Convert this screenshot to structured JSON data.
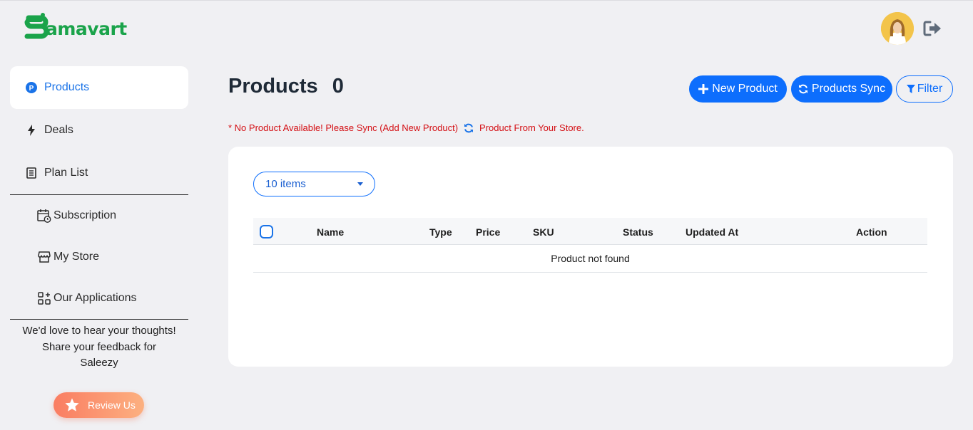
{
  "brand": {
    "name": "amavart",
    "color": "#1aa34a"
  },
  "header": {
    "avatar_icon": "user-avatar",
    "logout_icon": "sign-out-icon"
  },
  "sidebar": {
    "items": [
      {
        "label": "Products",
        "icon": "product-p-icon",
        "active": true
      },
      {
        "label": "Deals",
        "icon": "bolt-icon",
        "active": false
      },
      {
        "label": "Plan List",
        "icon": "list-icon",
        "active": false
      }
    ],
    "sub_items": [
      {
        "label": "Subscription",
        "icon": "calendar-clock-icon"
      },
      {
        "label": "My Store",
        "icon": "store-icon"
      },
      {
        "label": "Our Applications",
        "icon": "apps-icon"
      }
    ],
    "feedback": {
      "line1": "We'd love to hear your thoughts!",
      "line2": "Share your feedback for",
      "line3": "Saleezy"
    },
    "review_label": "Review Us"
  },
  "main": {
    "title": "Products",
    "count": "0",
    "buttons": {
      "new_product": "New Product",
      "products_sync": "Products Sync",
      "filter": "Filter"
    },
    "warning": {
      "part1": "* No Product Available! Please Sync (Add New Product)",
      "part2": "Product From Your Store.",
      "color": "#d40f14"
    },
    "items_select": "10 items",
    "table": {
      "columns": [
        "Name",
        "Type",
        "Price",
        "SKU",
        "Status",
        "Updated At",
        "Action"
      ],
      "empty_message": "Product not found"
    }
  },
  "colors": {
    "primary": "#0d6efd",
    "background": "#f0f0f3",
    "review_gradient_start": "#fa7d62",
    "review_gradient_end": "#fcb080"
  }
}
